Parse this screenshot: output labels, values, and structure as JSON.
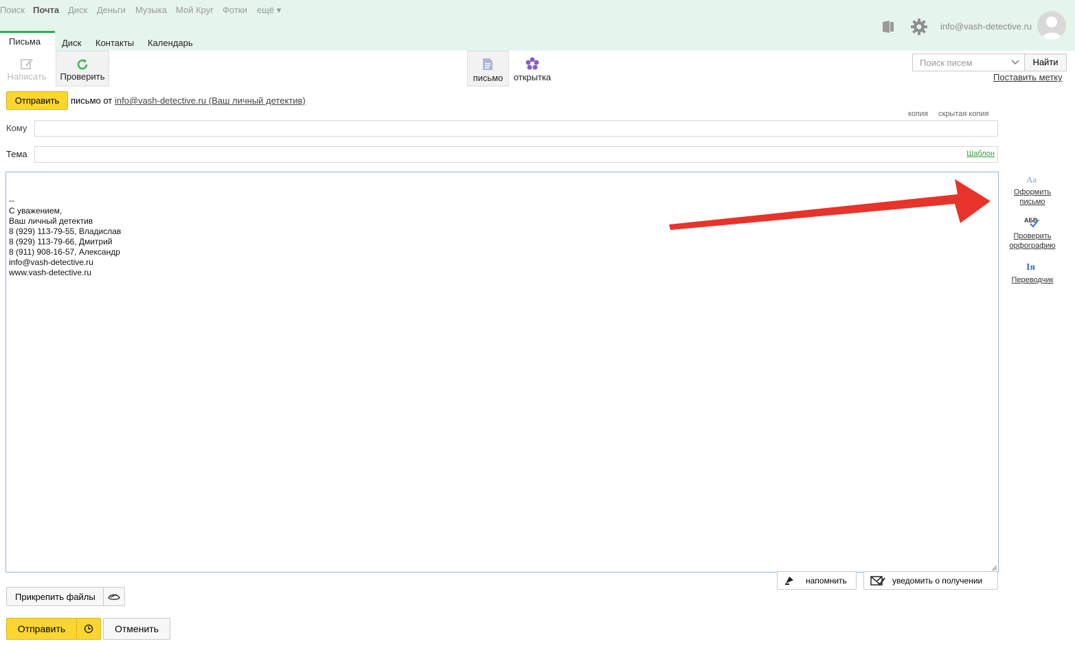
{
  "services": [
    "Поиск",
    "Почта",
    "Диск",
    "Деньги",
    "Музыка",
    "Мой Круг",
    "Фотки",
    "ещё ▾"
  ],
  "user": {
    "email": "info@vash-detective.ru"
  },
  "tabs": [
    "Письма",
    "Диск",
    "Контакты",
    "Календарь"
  ],
  "toolbar": {
    "write": "Написать",
    "check": "Проверить",
    "letter": "письмо",
    "postcard": "открытка"
  },
  "search": {
    "placeholder": "Поиск писем",
    "button": "Найти",
    "label_link": "Поставить метку"
  },
  "compose": {
    "send": "Отправить",
    "from_prefix": "письмо от",
    "from_address": "info@vash-detective.ru (Ваш личный детектив)",
    "cc": "копия",
    "bcc": "скрытая копия",
    "to_label": "Кому",
    "subject_label": "Тема",
    "template": "Шаблон",
    "body_lines": [
      "--",
      "С уважением,",
      "Ваш личный детектив",
      "8 (929) 113-79-55, Владислав",
      "8 (929) 113-79-66, Дмитрий",
      "8 (911) 908-16-57, Александр",
      "info@vash-detective.ru",
      "www.vash-detective.ru"
    ],
    "remind": "напомнить",
    "notify": "уведомить о получении",
    "attach": "Прикрепить файлы",
    "send_bottom": "Отправить",
    "cancel": "Отменить"
  },
  "side_tools": {
    "format_line1": "Оформить",
    "format_line2": "письмо",
    "spell_line1": "Проверить",
    "spell_line2": "орфографию",
    "translate": "Переводчик",
    "format_glyph": "Aa",
    "spell_glyph": "АБВ",
    "translate_glyph": "Iя"
  },
  "colors": {
    "accent_green": "#2bb24c",
    "send_yellow": "#fcd630",
    "arrow_red": "#e8332a",
    "topbar_bg": "#e6f5ec"
  }
}
